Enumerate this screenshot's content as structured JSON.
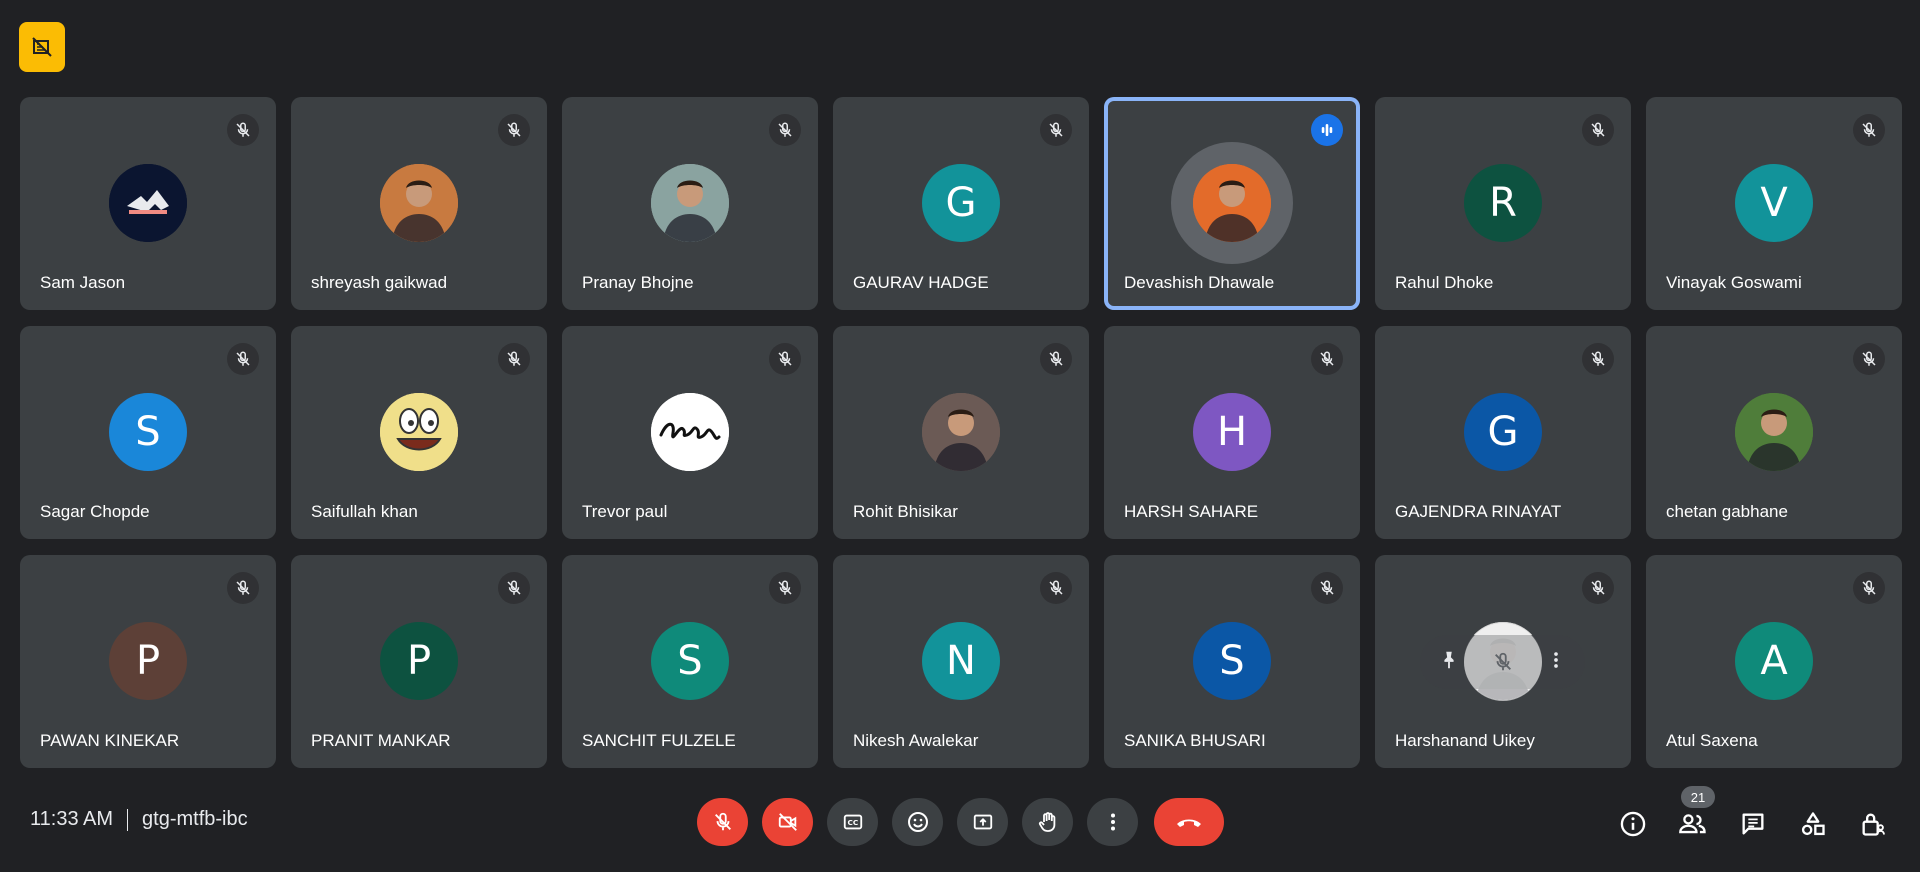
{
  "participants": [
    {
      "name": "Sam Jason",
      "avatar": {
        "type": "image",
        "icon": "logo-avatar",
        "color": "#0b1530"
      }
    },
    {
      "name": "shreyash gaikwad",
      "avatar": {
        "type": "image",
        "icon": "person-photo-avatar",
        "color": "#c87a40"
      }
    },
    {
      "name": "Pranay Bhojne",
      "avatar": {
        "type": "image",
        "icon": "person-photo-avatar",
        "color": "#8aa3a0"
      }
    },
    {
      "name": "GAURAV HADGE",
      "avatar": {
        "type": "letter",
        "letter": "G",
        "color": "#12939a"
      }
    },
    {
      "name": "Devashish Dhawale",
      "avatar": {
        "type": "image",
        "icon": "person-photo-avatar",
        "color": "#e36b2a"
      },
      "speaking": true
    },
    {
      "name": "Rahul Dhoke",
      "avatar": {
        "type": "letter",
        "letter": "R",
        "color": "#0d5240"
      }
    },
    {
      "name": "Vinayak Goswami",
      "avatar": {
        "type": "letter",
        "letter": "V",
        "color": "#12939a"
      }
    },
    {
      "name": "Sagar Chopde",
      "avatar": {
        "type": "letter",
        "letter": "S",
        "color": "#1a87d9"
      }
    },
    {
      "name": "Saifullah khan",
      "avatar": {
        "type": "image",
        "icon": "smiley-face-avatar",
        "color": "#f0df8a"
      }
    },
    {
      "name": "Trevor paul",
      "avatar": {
        "type": "image",
        "icon": "enjoy-text-avatar",
        "color": "#ffffff"
      }
    },
    {
      "name": "Rohit Bhisikar",
      "avatar": {
        "type": "image",
        "icon": "person-photo-avatar",
        "color": "#6b5a55"
      }
    },
    {
      "name": "HARSH SAHARE",
      "avatar": {
        "type": "letter",
        "letter": "H",
        "color": "#7e57c2"
      }
    },
    {
      "name": "GAJENDRA RINAYAT",
      "avatar": {
        "type": "letter",
        "letter": "G",
        "color": "#0b57a6"
      }
    },
    {
      "name": "chetan gabhane",
      "avatar": {
        "type": "image",
        "icon": "person-photo-avatar",
        "color": "#4f7d3a"
      }
    },
    {
      "name": "PAWAN KINEKAR",
      "avatar": {
        "type": "letter",
        "letter": "P",
        "color": "#5d4037"
      }
    },
    {
      "name": "PRANIT MANKAR",
      "avatar": {
        "type": "letter",
        "letter": "P",
        "color": "#0d5240"
      }
    },
    {
      "name": "SANCHIT FULZELE",
      "avatar": {
        "type": "letter",
        "letter": "S",
        "color": "#0f8a7a"
      }
    },
    {
      "name": "Nikesh Awalekar",
      "avatar": {
        "type": "letter",
        "letter": "N",
        "color": "#12939a"
      }
    },
    {
      "name": "SANIKA BHUSARI",
      "avatar": {
        "type": "letter",
        "letter": "S",
        "color": "#0b57a6"
      }
    },
    {
      "name": "Harshanand Uikey",
      "avatar": {
        "type": "image",
        "icon": "person-photo-avatar",
        "color": "#d7d7d7"
      },
      "hover_controls": true
    },
    {
      "name": "Atul Saxena",
      "avatar": {
        "type": "letter",
        "letter": "A",
        "color": "#0f8a7a"
      }
    }
  ],
  "footer": {
    "time": "11:33 AM",
    "meeting_code": "gtg-mtfb-ibc",
    "participant_count": "21"
  },
  "colors": {
    "background": "#202124",
    "tile": "#3c4043",
    "danger": "#ea4335",
    "accent": "#8ab4f8",
    "badge": "#fbbc04"
  }
}
